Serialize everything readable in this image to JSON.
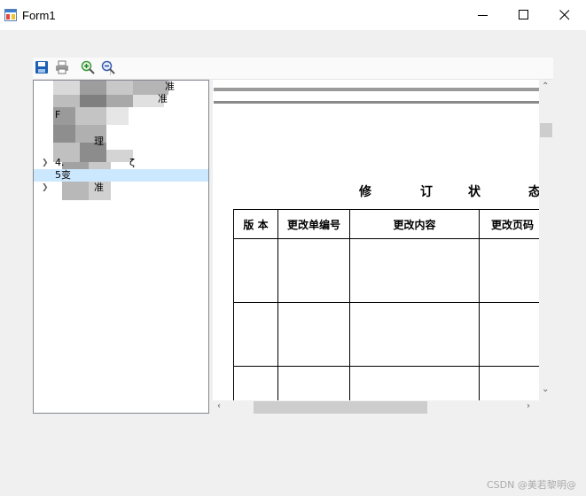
{
  "window": {
    "title": "Form1",
    "icon": "winforms-app-icon",
    "controls": [
      "minimize-icon",
      "maximize-icon",
      "close-icon"
    ]
  },
  "toolbar": {
    "buttons": [
      {
        "name": "save",
        "icon": "save-floppy-icon"
      },
      {
        "name": "print",
        "icon": "printer-icon"
      },
      {
        "name": "zoom-in",
        "icon": "zoom-in-icon"
      },
      {
        "name": "zoom-out",
        "icon": "zoom-out-icon"
      }
    ]
  },
  "tree": {
    "items": [
      {
        "label": "准",
        "expandable": false
      },
      {
        "label": "准",
        "expandable": false
      },
      {
        "label": "F",
        "expandable": false
      },
      {
        "label": "理",
        "expandable": false
      },
      {
        "label": "4.",
        "suffix": "ζ",
        "expandable": true
      },
      {
        "label": "5变",
        "expandable": false,
        "selected": true
      },
      {
        "label": "准",
        "expandable": true
      }
    ]
  },
  "document": {
    "title_chars": [
      "修",
      "订",
      "状",
      "态"
    ],
    "table": {
      "headers": [
        "版 本",
        "更改单编号",
        "更改内容",
        "更改页码"
      ],
      "rows": [
        [
          "",
          "",
          "",
          ""
        ],
        [
          "",
          "",
          "",
          ""
        ],
        [
          "",
          "",
          "",
          ""
        ]
      ]
    }
  },
  "watermark": "CSDN @美若黎明@",
  "colors": {
    "selection": "#cce8ff",
    "window_bg": "#f0f0f0",
    "tree_border": "#828790"
  }
}
